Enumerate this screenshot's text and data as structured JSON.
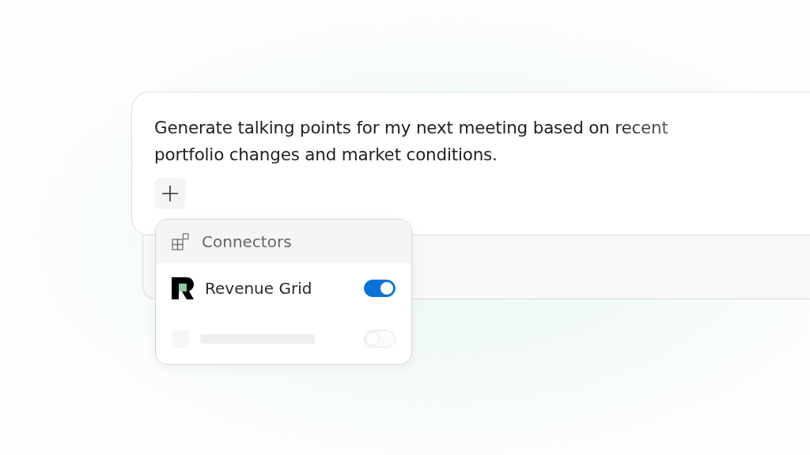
{
  "prompt": {
    "text": "Generate talking points for my next meeting based on recent portfolio changes and market conditions."
  },
  "connectors_menu": {
    "title": "Connectors",
    "items": [
      {
        "kind": "app",
        "name": "Revenue Grid",
        "on": true
      },
      {
        "kind": "placeholder",
        "on": false
      }
    ]
  }
}
